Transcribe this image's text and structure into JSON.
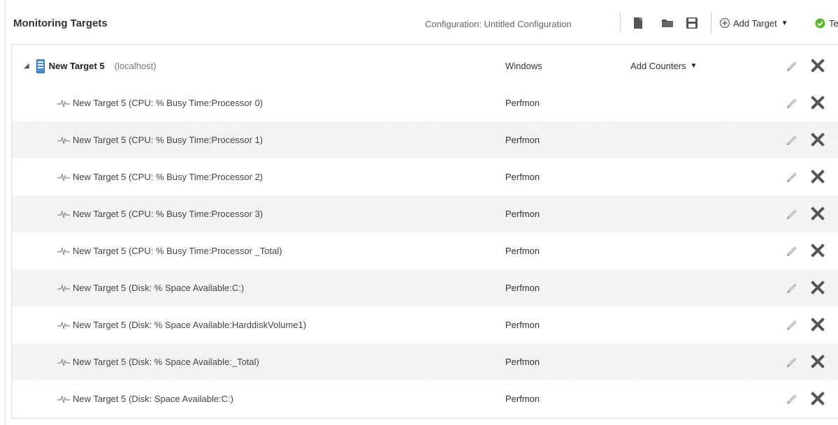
{
  "header": {
    "title": "Monitoring Targets",
    "configuration_label": "Configuration: Untitled Configuration",
    "toolbar": {
      "icons": [
        "new-config-icon",
        "open-folder-icon",
        "save-icon"
      ],
      "add_target_label": "Add Target",
      "test_label": "Te"
    }
  },
  "target": {
    "name": "New Target 5",
    "host": "(localhost)",
    "type": "Windows",
    "add_counters_label": "Add Counters"
  },
  "counters": [
    {
      "name": "New Target 5 (CPU: % Busy Time:Processor 0)",
      "type": "Perfmon"
    },
    {
      "name": "New Target 5 (CPU: % Busy Time:Processor 1)",
      "type": "Perfmon"
    },
    {
      "name": "New Target 5 (CPU: % Busy Time:Processor 2)",
      "type": "Perfmon"
    },
    {
      "name": "New Target 5 (CPU: % Busy Time:Processor 3)",
      "type": "Perfmon"
    },
    {
      "name": "New Target 5 (CPU: % Busy Time:Processor _Total)",
      "type": "Perfmon"
    },
    {
      "name": "New Target 5 (Disk: % Space Available:C:)",
      "type": "Perfmon"
    },
    {
      "name": "New Target 5 (Disk: % Space Available:HarddiskVolume1)",
      "type": "Perfmon"
    },
    {
      "name": "New Target 5 (Disk: % Space Available:_Total)",
      "type": "Perfmon"
    },
    {
      "name": "New Target 5 (Disk: Space Available:C:)",
      "type": "Perfmon"
    }
  ],
  "colors": {
    "test_ok": "#5cb82e",
    "delete_icon": "#555555",
    "edit_icon": "#b5b5b5",
    "server_icon": "#4a90d9"
  }
}
